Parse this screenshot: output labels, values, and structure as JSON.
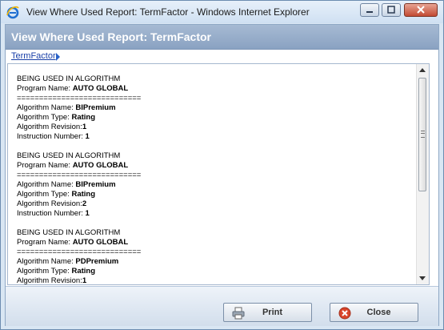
{
  "window": {
    "title": "View Where Used Report: TermFactor - Windows Internet Explorer"
  },
  "header": {
    "title": "View Where Used Report: TermFactor"
  },
  "breadcrumb": {
    "label": "TermFactor"
  },
  "report": {
    "entries": [
      {
        "heading": "BEING USED IN ALGORITHM",
        "program_label": "Program Name: ",
        "program_value": "AUTO GLOBAL",
        "separator": "============================",
        "algorithm_name_label": "Algorithm Name: ",
        "algorithm_name_value": "BIPremium",
        "algorithm_type_label": "Algorithm Type: ",
        "algorithm_type_value": "Rating",
        "revision_label": "Algorithm Revision:",
        "revision_value": "1",
        "instruction_label": "Instruction Number: ",
        "instruction_value": "1"
      },
      {
        "heading": "BEING USED IN ALGORITHM",
        "program_label": "Program Name: ",
        "program_value": "AUTO GLOBAL",
        "separator": "============================",
        "algorithm_name_label": "Algorithm Name: ",
        "algorithm_name_value": "BIPremium",
        "algorithm_type_label": "Algorithm Type: ",
        "algorithm_type_value": "Rating",
        "revision_label": "Algorithm Revision:",
        "revision_value": "2",
        "instruction_label": "Instruction Number: ",
        "instruction_value": "1"
      },
      {
        "heading": "BEING USED IN ALGORITHM",
        "program_label": "Program Name: ",
        "program_value": "AUTO GLOBAL",
        "separator": "============================",
        "algorithm_name_label": "Algorithm Name: ",
        "algorithm_name_value": "PDPremium",
        "algorithm_type_label": "Algorithm Type: ",
        "algorithm_type_value": "Rating",
        "revision_label": "Algorithm Revision:",
        "revision_value": "1"
      }
    ]
  },
  "footer": {
    "print_label": "Print",
    "close_label": "Close"
  },
  "icons": {
    "browser": "internet-explorer-icon",
    "print": "printer-icon",
    "close": "close-circle-icon"
  },
  "colors": {
    "header_bg": "#8aa2c2",
    "link": "#1a40a8",
    "close_icon": "#d9452b"
  }
}
